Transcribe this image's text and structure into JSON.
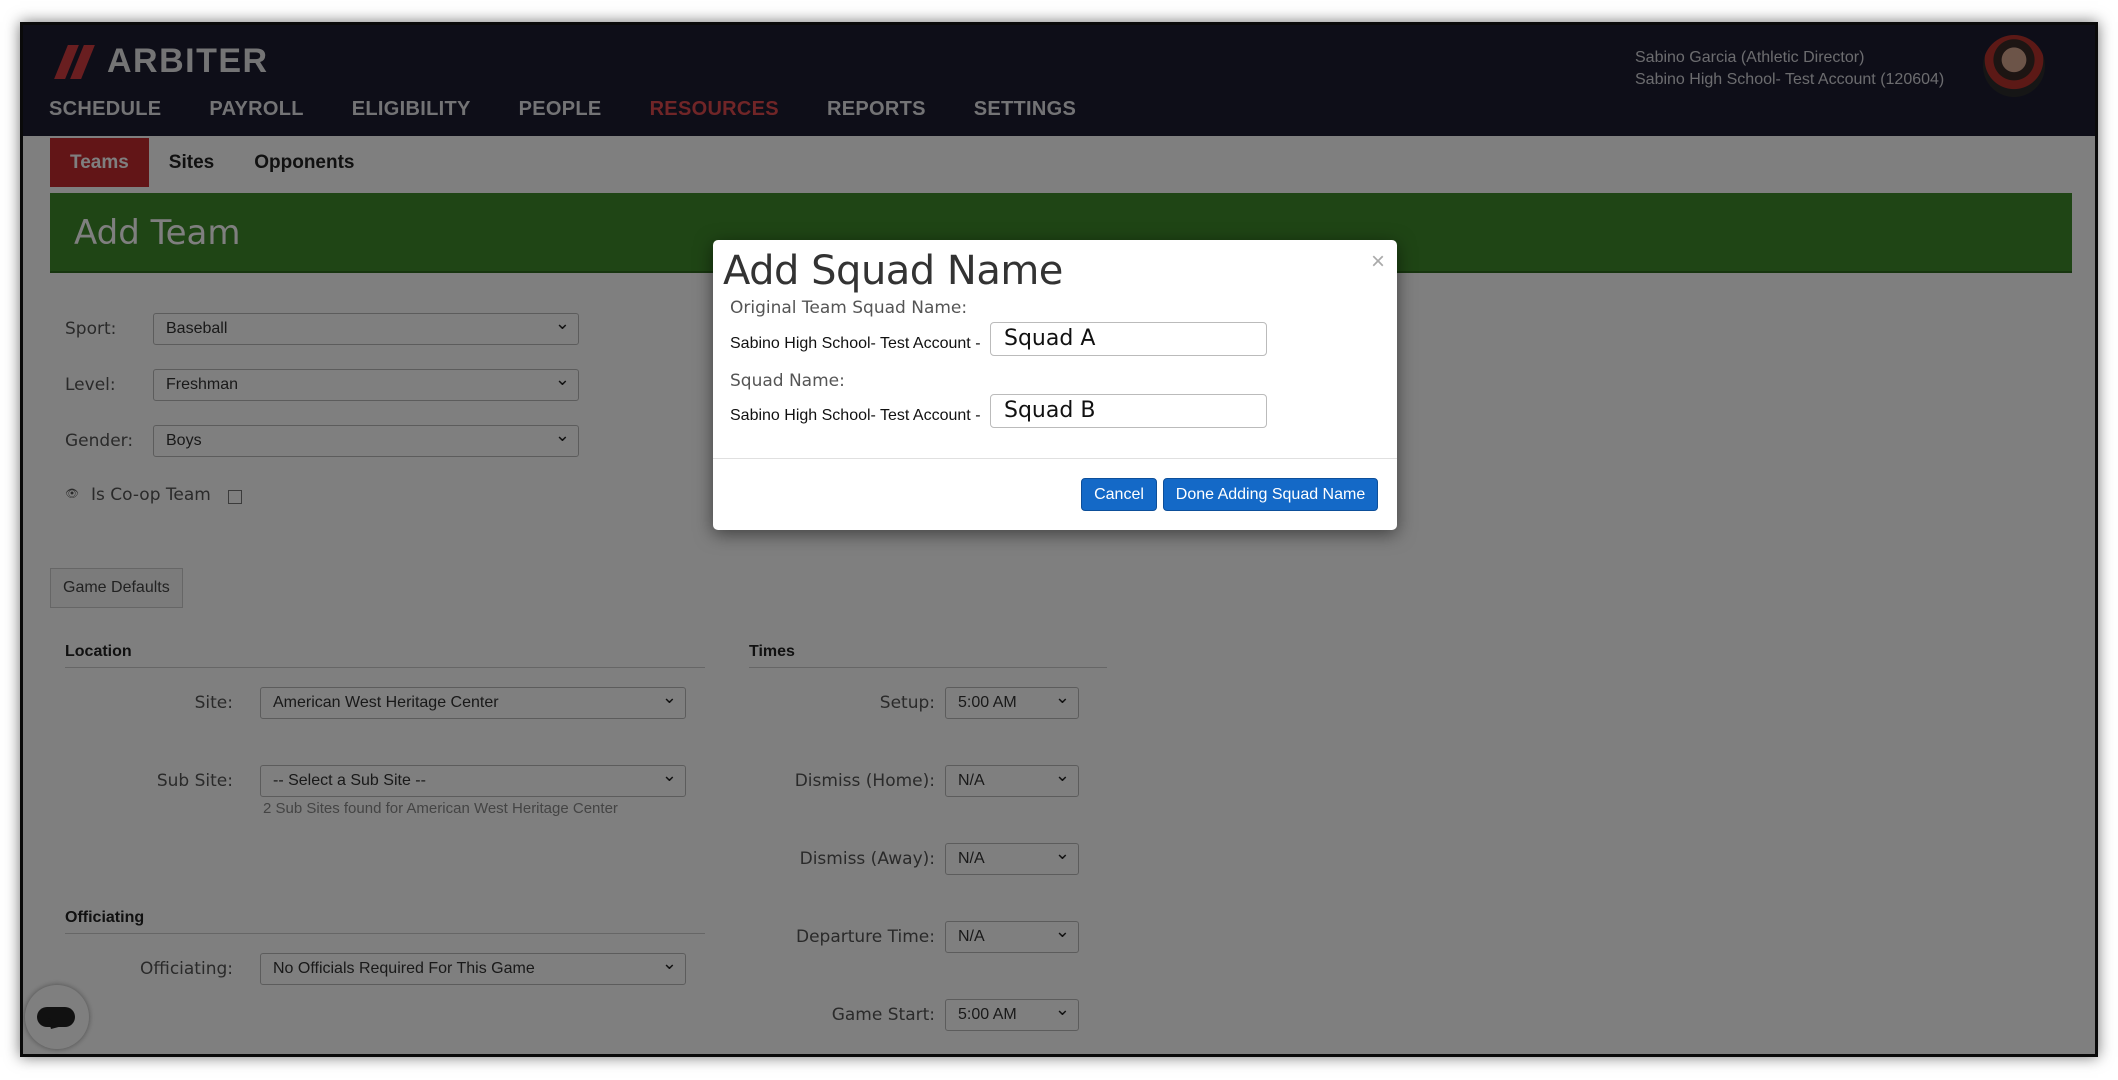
{
  "brand": {
    "name": "ARBITER",
    "accent": "#d23c40"
  },
  "nav": [
    "SCHEDULE",
    "PAYROLL",
    "ELIGIBILITY",
    "PEOPLE",
    "RESOURCES",
    "REPORTS",
    "SETTINGS"
  ],
  "nav_active": "RESOURCES",
  "user": {
    "name": "Sabino Garcia (Athletic Director)",
    "account": "Sabino High School- Test Account (120604)"
  },
  "subtabs": [
    "Teams",
    "Sites",
    "Opponents"
  ],
  "page_title": "Add Team",
  "form": {
    "sport_label": "Sport:",
    "sport_value": "Baseball",
    "level_label": "Level:",
    "level_value": "Freshman",
    "gender_label": "Gender:",
    "gender_value": "Boys",
    "coop_label": "Is Co-op Team",
    "game_defaults": "Game Defaults"
  },
  "location": {
    "heading": "Location",
    "site_label": "Site:",
    "site_value": "American West Heritage Center",
    "subsite_label": "Sub Site:",
    "subsite_value": "-- Select a Sub Site --",
    "subsite_hint": "2 Sub Sites found for American West Heritage Center"
  },
  "officiating": {
    "heading": "Officiating",
    "label": "Officiating:",
    "value": "No Officials Required For This Game"
  },
  "times": {
    "heading": "Times",
    "setup_label": "Setup:",
    "setup_value": "5:00 AM",
    "dismiss_home_label": "Dismiss (Home):",
    "dismiss_home_value": "N/A",
    "dismiss_away_label": "Dismiss (Away):",
    "dismiss_away_value": "N/A",
    "departure_label": "Departure Time:",
    "departure_value": "N/A",
    "game_start_label": "Game Start:",
    "game_start_value": "5:00 AM"
  },
  "modal": {
    "title": "Add Squad Name",
    "close": "×",
    "original_label": "Original Team Squad Name:",
    "prefix": "Sabino High School- Test Account -",
    "original_value": "Squad A",
    "squad_label": "Squad Name:",
    "squad_value": "Squad B",
    "cancel": "Cancel",
    "done": "Done Adding Squad Name"
  }
}
